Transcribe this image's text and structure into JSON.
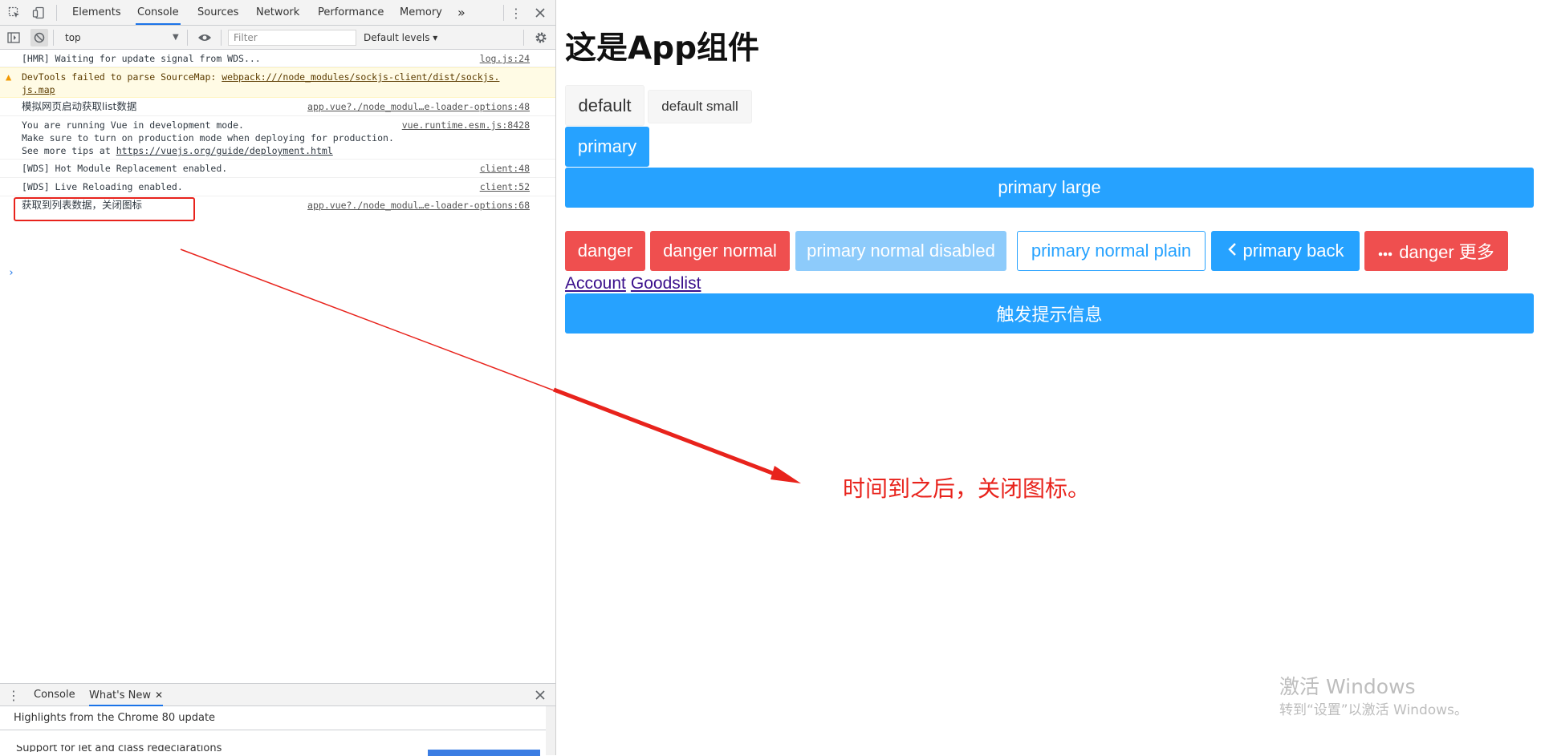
{
  "devtools": {
    "tabs": [
      "Elements",
      "Console",
      "Sources",
      "Network",
      "Performance",
      "Memory"
    ],
    "active_tab": "Console",
    "more_tabs": "»",
    "context": "top",
    "filter_placeholder": "Filter",
    "levels": "Default levels ▾",
    "messages": [
      {
        "text": "[HMR] Waiting for update signal from WDS...",
        "source": "log.js:24"
      },
      {
        "text_prefix": "DevTools failed to parse SourceMap: ",
        "link": "webpack:///node_modules/sockjs-client/dist/sockjs.",
        "link_cont": "js.map"
      },
      {
        "text": "模拟网页启动获取list数据",
        "source": "app.vue?./node_modul…e-loader-options:48"
      },
      {
        "line1": "You are running Vue in development mode.",
        "line2": "Make sure to turn on production mode when deploying for production.",
        "line3_prefix": "See more tips at ",
        "line3_link": "https://vuejs.org/guide/deployment.html",
        "source": "vue.runtime.esm.js:8428"
      },
      {
        "text": "[WDS] Hot Module Replacement enabled.",
        "source": "client:48"
      },
      {
        "text": "[WDS] Live Reloading enabled.",
        "source": "client:52"
      },
      {
        "text": "获取到列表数据，关闭图标",
        "source": "app.vue?./node_modul…e-loader-options:68"
      }
    ],
    "prompt": "›",
    "drawer": {
      "tabs": [
        "Console",
        "What's New"
      ],
      "active_tab": "What's New",
      "headline": "Highlights from the Chrome 80 update",
      "next_item": "Support for let and class redeclarations"
    }
  },
  "app": {
    "title": "这是App组件",
    "buttons": {
      "default": "default",
      "default_small": "default small",
      "primary": "primary",
      "primary_large": "primary large",
      "danger": "danger",
      "danger_normal": "danger normal",
      "primary_normal_disabled": "primary normal disabled",
      "primary_normal_plain": "primary normal plain",
      "primary_back": "primary back",
      "danger_more": "danger 更多",
      "trigger_toast": "触发提示信息"
    },
    "links": [
      "Account",
      "Goodslist"
    ]
  },
  "annotation": "时间到之后，关闭图标。",
  "watermark": {
    "line1": "激活 Windows",
    "line2": "转到“设置”以激活 Windows。"
  },
  "colors": {
    "primary": "#26a2ff",
    "danger": "#ef4f4f",
    "annotation_red": "#e8231c",
    "devtools_accent": "#1a73e8"
  }
}
